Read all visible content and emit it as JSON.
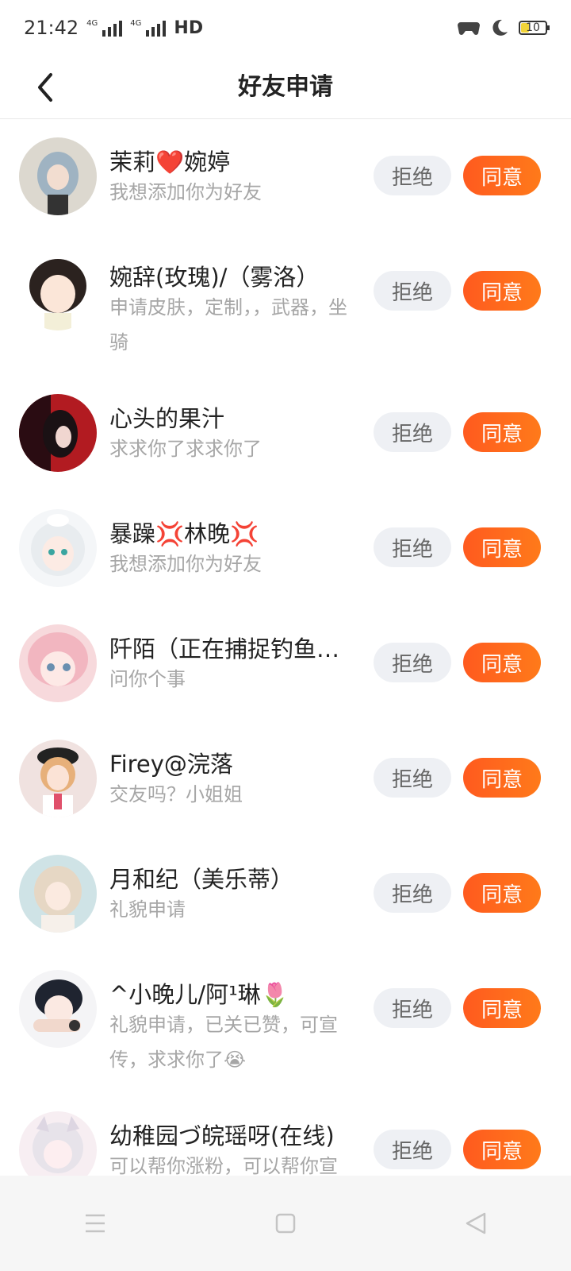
{
  "status_bar": {
    "time": "21:42",
    "signal_label_1": "4G",
    "signal_label_2": "4G",
    "network": "HD",
    "battery": "10"
  },
  "header": {
    "title": "好友申请"
  },
  "buttons": {
    "reject": "拒绝",
    "accept": "同意"
  },
  "requests": [
    {
      "name": "茉莉❤️婉婷",
      "message": "我想添加你为好友"
    },
    {
      "name": "婉辞(玫瑰)/（雾洛）",
      "message": "申请皮肤，定制，，武器，坐骑"
    },
    {
      "name": "心头的果汁",
      "message": "求求你了求求你了"
    },
    {
      "name": "暴躁💢林晚💢",
      "message": "我想添加你为好友"
    },
    {
      "name": "阡陌（正在捕捉钓鱼一…",
      "message": "问你个事"
    },
    {
      "name": "Firey@浣落",
      "message": "交友吗？小姐姐"
    },
    {
      "name": "月和纪（美乐蒂）",
      "message": "礼貌申请"
    },
    {
      "name": "^小晚儿/阿¹琳🌷",
      "message": "礼貌申请，已关已赞，可宣传，求求你了😭"
    },
    {
      "name": "幼稚园づ皖瑶呀(在线)",
      "message": "可以帮你涨粉，可以帮你宣"
    }
  ],
  "icons": {
    "back": "back-arrow-icon",
    "nav_menu": "menu-icon",
    "nav_home": "home-square-icon",
    "nav_back": "back-triangle-icon"
  },
  "colors": {
    "accent": "#ff5a1f",
    "reject_bg": "#eef0f4",
    "secondary_text": "#a6a6a6"
  }
}
